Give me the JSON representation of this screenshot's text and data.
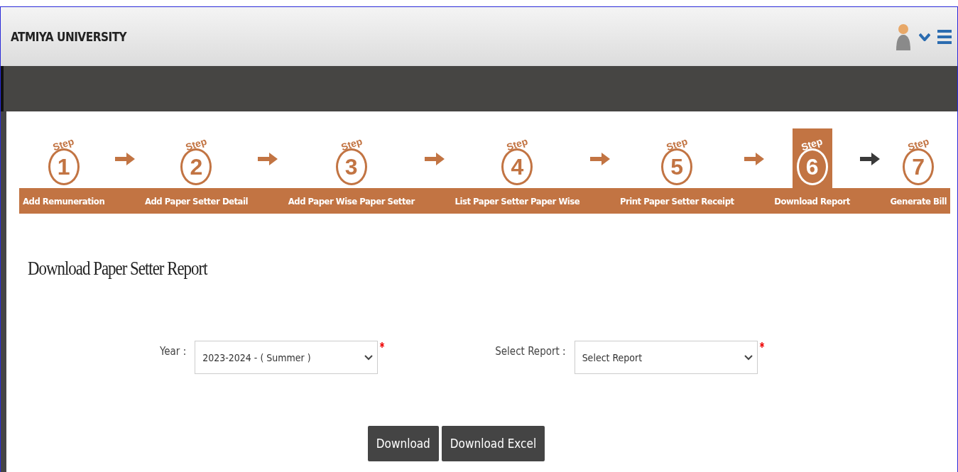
{
  "header": {
    "title": "ATMIYA UNIVERSITY"
  },
  "steps": [
    {
      "step": "Step",
      "number": "1",
      "label": "Add Remuneration",
      "selected": false
    },
    {
      "step": "Step",
      "number": "2",
      "label": "Add Paper Setter Detail",
      "selected": false
    },
    {
      "step": "Step",
      "number": "3",
      "label": "Add Paper Wise Paper Setter",
      "selected": false
    },
    {
      "step": "Step",
      "number": "4",
      "label": "List Paper Setter Paper Wise",
      "selected": false
    },
    {
      "step": "Step",
      "number": "5",
      "label": "Print Paper Setter Receipt",
      "selected": false
    },
    {
      "step": "Step",
      "number": "6",
      "label": "Download Report",
      "selected": true
    },
    {
      "step": "Step",
      "number": "7",
      "label": "Generate Bill",
      "selected": false
    }
  ],
  "page_title": "Download Paper Setter Report",
  "fields": [
    {
      "label": "Year :",
      "value": "2023-2024 - ( Summer )",
      "required": true
    },
    {
      "label": "Select Report :",
      "value": "Select Report",
      "required": true
    }
  ],
  "buttons": [
    "Download",
    "Download Excel"
  ]
}
